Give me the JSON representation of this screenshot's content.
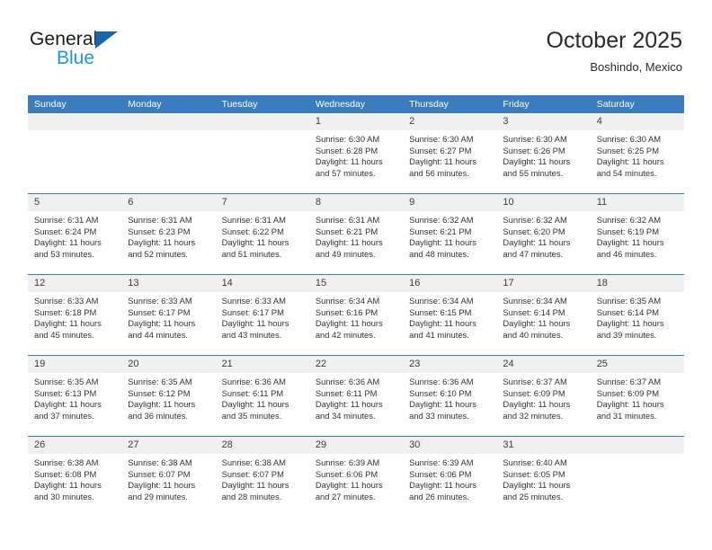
{
  "brand": {
    "name_top": "General",
    "name_bottom": "Blue",
    "logo_icon": "triangle-logo-icon"
  },
  "header": {
    "title": "October 2025",
    "subtitle": "Boshindo, Mexico"
  },
  "theme": {
    "header_blue": "#3a7cbe",
    "brand_blue": "#2196e8",
    "logo_blue": "#1267b2",
    "daynum_band": "#f0f0f0",
    "text": "#333333"
  },
  "weekday_headers": [
    "Sunday",
    "Monday",
    "Tuesday",
    "Wednesday",
    "Thursday",
    "Friday",
    "Saturday"
  ],
  "labels": {
    "sunrise": "Sunrise:",
    "sunset": "Sunset:",
    "daylight": "Daylight:"
  },
  "weeks": [
    [
      {
        "day": "",
        "empty": true
      },
      {
        "day": "",
        "empty": true
      },
      {
        "day": "",
        "empty": true
      },
      {
        "day": "1",
        "sunrise": "Sunrise: 6:30 AM",
        "sunset": "Sunset: 6:28 PM",
        "daylight1": "Daylight: 11 hours",
        "daylight2": "and 57 minutes."
      },
      {
        "day": "2",
        "sunrise": "Sunrise: 6:30 AM",
        "sunset": "Sunset: 6:27 PM",
        "daylight1": "Daylight: 11 hours",
        "daylight2": "and 56 minutes."
      },
      {
        "day": "3",
        "sunrise": "Sunrise: 6:30 AM",
        "sunset": "Sunset: 6:26 PM",
        "daylight1": "Daylight: 11 hours",
        "daylight2": "and 55 minutes."
      },
      {
        "day": "4",
        "sunrise": "Sunrise: 6:30 AM",
        "sunset": "Sunset: 6:25 PM",
        "daylight1": "Daylight: 11 hours",
        "daylight2": "and 54 minutes."
      }
    ],
    [
      {
        "day": "5",
        "sunrise": "Sunrise: 6:31 AM",
        "sunset": "Sunset: 6:24 PM",
        "daylight1": "Daylight: 11 hours",
        "daylight2": "and 53 minutes."
      },
      {
        "day": "6",
        "sunrise": "Sunrise: 6:31 AM",
        "sunset": "Sunset: 6:23 PM",
        "daylight1": "Daylight: 11 hours",
        "daylight2": "and 52 minutes."
      },
      {
        "day": "7",
        "sunrise": "Sunrise: 6:31 AM",
        "sunset": "Sunset: 6:22 PM",
        "daylight1": "Daylight: 11 hours",
        "daylight2": "and 51 minutes."
      },
      {
        "day": "8",
        "sunrise": "Sunrise: 6:31 AM",
        "sunset": "Sunset: 6:21 PM",
        "daylight1": "Daylight: 11 hours",
        "daylight2": "and 49 minutes."
      },
      {
        "day": "9",
        "sunrise": "Sunrise: 6:32 AM",
        "sunset": "Sunset: 6:21 PM",
        "daylight1": "Daylight: 11 hours",
        "daylight2": "and 48 minutes."
      },
      {
        "day": "10",
        "sunrise": "Sunrise: 6:32 AM",
        "sunset": "Sunset: 6:20 PM",
        "daylight1": "Daylight: 11 hours",
        "daylight2": "and 47 minutes."
      },
      {
        "day": "11",
        "sunrise": "Sunrise: 6:32 AM",
        "sunset": "Sunset: 6:19 PM",
        "daylight1": "Daylight: 11 hours",
        "daylight2": "and 46 minutes."
      }
    ],
    [
      {
        "day": "12",
        "sunrise": "Sunrise: 6:33 AM",
        "sunset": "Sunset: 6:18 PM",
        "daylight1": "Daylight: 11 hours",
        "daylight2": "and 45 minutes."
      },
      {
        "day": "13",
        "sunrise": "Sunrise: 6:33 AM",
        "sunset": "Sunset: 6:17 PM",
        "daylight1": "Daylight: 11 hours",
        "daylight2": "and 44 minutes."
      },
      {
        "day": "14",
        "sunrise": "Sunrise: 6:33 AM",
        "sunset": "Sunset: 6:17 PM",
        "daylight1": "Daylight: 11 hours",
        "daylight2": "and 43 minutes."
      },
      {
        "day": "15",
        "sunrise": "Sunrise: 6:34 AM",
        "sunset": "Sunset: 6:16 PM",
        "daylight1": "Daylight: 11 hours",
        "daylight2": "and 42 minutes."
      },
      {
        "day": "16",
        "sunrise": "Sunrise: 6:34 AM",
        "sunset": "Sunset: 6:15 PM",
        "daylight1": "Daylight: 11 hours",
        "daylight2": "and 41 minutes."
      },
      {
        "day": "17",
        "sunrise": "Sunrise: 6:34 AM",
        "sunset": "Sunset: 6:14 PM",
        "daylight1": "Daylight: 11 hours",
        "daylight2": "and 40 minutes."
      },
      {
        "day": "18",
        "sunrise": "Sunrise: 6:35 AM",
        "sunset": "Sunset: 6:14 PM",
        "daylight1": "Daylight: 11 hours",
        "daylight2": "and 39 minutes."
      }
    ],
    [
      {
        "day": "19",
        "sunrise": "Sunrise: 6:35 AM",
        "sunset": "Sunset: 6:13 PM",
        "daylight1": "Daylight: 11 hours",
        "daylight2": "and 37 minutes."
      },
      {
        "day": "20",
        "sunrise": "Sunrise: 6:35 AM",
        "sunset": "Sunset: 6:12 PM",
        "daylight1": "Daylight: 11 hours",
        "daylight2": "and 36 minutes."
      },
      {
        "day": "21",
        "sunrise": "Sunrise: 6:36 AM",
        "sunset": "Sunset: 6:11 PM",
        "daylight1": "Daylight: 11 hours",
        "daylight2": "and 35 minutes."
      },
      {
        "day": "22",
        "sunrise": "Sunrise: 6:36 AM",
        "sunset": "Sunset: 6:11 PM",
        "daylight1": "Daylight: 11 hours",
        "daylight2": "and 34 minutes."
      },
      {
        "day": "23",
        "sunrise": "Sunrise: 6:36 AM",
        "sunset": "Sunset: 6:10 PM",
        "daylight1": "Daylight: 11 hours",
        "daylight2": "and 33 minutes."
      },
      {
        "day": "24",
        "sunrise": "Sunrise: 6:37 AM",
        "sunset": "Sunset: 6:09 PM",
        "daylight1": "Daylight: 11 hours",
        "daylight2": "and 32 minutes."
      },
      {
        "day": "25",
        "sunrise": "Sunrise: 6:37 AM",
        "sunset": "Sunset: 6:09 PM",
        "daylight1": "Daylight: 11 hours",
        "daylight2": "and 31 minutes."
      }
    ],
    [
      {
        "day": "26",
        "sunrise": "Sunrise: 6:38 AM",
        "sunset": "Sunset: 6:08 PM",
        "daylight1": "Daylight: 11 hours",
        "daylight2": "and 30 minutes."
      },
      {
        "day": "27",
        "sunrise": "Sunrise: 6:38 AM",
        "sunset": "Sunset: 6:07 PM",
        "daylight1": "Daylight: 11 hours",
        "daylight2": "and 29 minutes."
      },
      {
        "day": "28",
        "sunrise": "Sunrise: 6:38 AM",
        "sunset": "Sunset: 6:07 PM",
        "daylight1": "Daylight: 11 hours",
        "daylight2": "and 28 minutes."
      },
      {
        "day": "29",
        "sunrise": "Sunrise: 6:39 AM",
        "sunset": "Sunset: 6:06 PM",
        "daylight1": "Daylight: 11 hours",
        "daylight2": "and 27 minutes."
      },
      {
        "day": "30",
        "sunrise": "Sunrise: 6:39 AM",
        "sunset": "Sunset: 6:06 PM",
        "daylight1": "Daylight: 11 hours",
        "daylight2": "and 26 minutes."
      },
      {
        "day": "31",
        "sunrise": "Sunrise: 6:40 AM",
        "sunset": "Sunset: 6:05 PM",
        "daylight1": "Daylight: 11 hours",
        "daylight2": "and 25 minutes."
      },
      {
        "day": "",
        "empty": true
      }
    ]
  ]
}
